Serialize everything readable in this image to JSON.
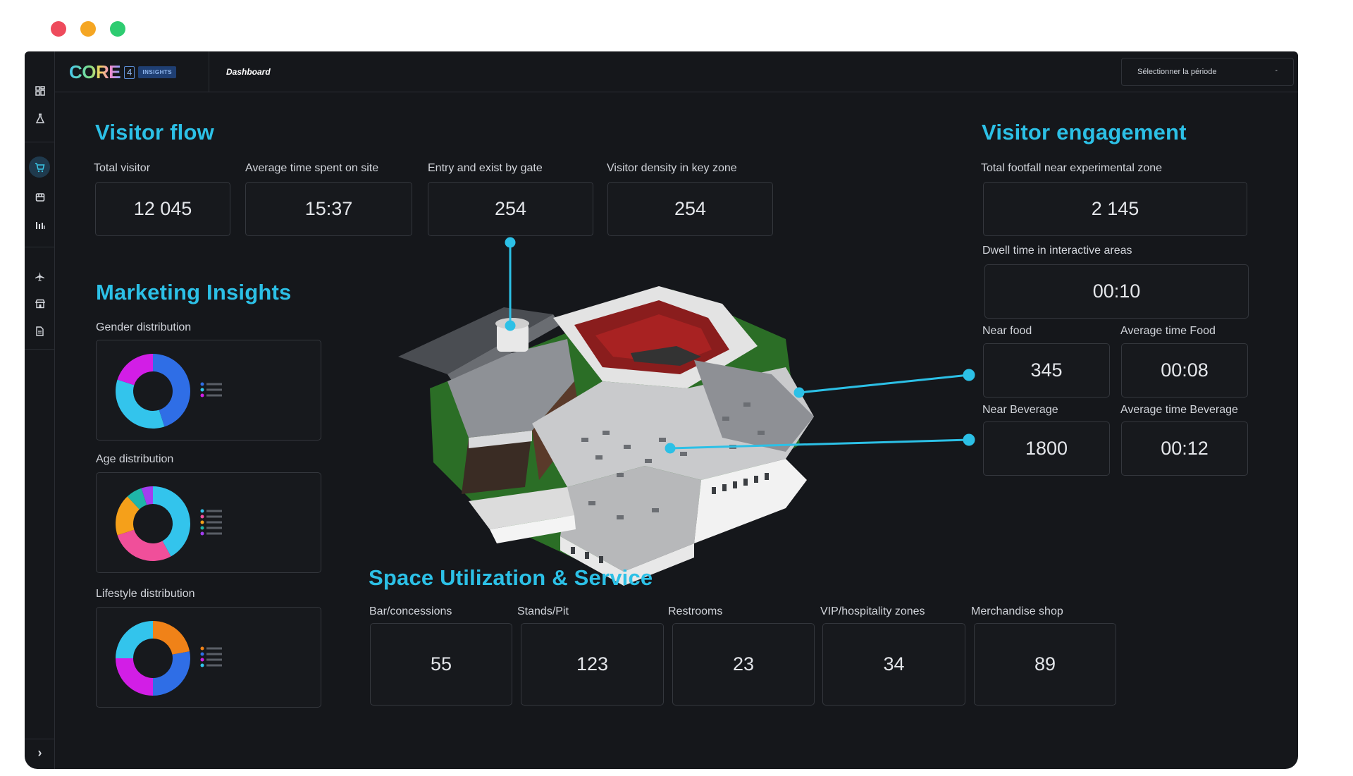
{
  "window_controls": {
    "close_color": "#ee4b5c",
    "minimize_color": "#f5a623",
    "maximize_color": "#2ecc71"
  },
  "brand": {
    "logo_text": "CORE",
    "logo_number": "4",
    "logo_badge": "INSIGHTS"
  },
  "breadcrumb": "Dashboard",
  "period_select": {
    "label": "Sélectionner la période",
    "caret": "-"
  },
  "sidebar": {
    "icons": [
      "dashboard-icon",
      "flask-icon",
      "cart-icon",
      "store-icon",
      "bar-chart-icon",
      "plane-icon",
      "shop-icon",
      "document-icon"
    ],
    "expand": "›"
  },
  "visitor_flow": {
    "title": "Visitor flow",
    "metrics": [
      {
        "label": "Total visitor",
        "value": "12 045"
      },
      {
        "label": "Average time spent on site",
        "value": "15:37"
      },
      {
        "label": "Entry and exist by gate",
        "value": "254"
      },
      {
        "label": "Visitor density in key zone",
        "value": "254"
      }
    ]
  },
  "marketing": {
    "title": "Marketing Insights",
    "gender_label": "Gender distribution",
    "age_label": "Age distribution",
    "lifestyle_label": "Lifestyle distribution"
  },
  "engagement": {
    "title": "Visitor engagement",
    "footfall": {
      "label": "Total footfall near experimental zone",
      "value": "2 145"
    },
    "dwell": {
      "label": "Dwell time in interactive areas",
      "value": "00:10"
    },
    "near_food": {
      "label": "Near food",
      "value": "345"
    },
    "avg_food": {
      "label": "Average time Food",
      "value": "00:08"
    },
    "near_bev": {
      "label": "Near Beverage",
      "value": "1800"
    },
    "avg_bev": {
      "label": "Average time Beverage",
      "value": "00:12"
    }
  },
  "space": {
    "title": "Space Utilization & Service",
    "metrics": [
      {
        "label": "Bar/concessions",
        "value": "55"
      },
      {
        "label": "Stands/Pit",
        "value": "123"
      },
      {
        "label": "Restrooms",
        "value": "23"
      },
      {
        "label": "VIP/hospitality zones",
        "value": "34"
      },
      {
        "label": "Merchandise shop",
        "value": "89"
      }
    ]
  },
  "chart_data": [
    {
      "type": "pie",
      "name": "gender",
      "values": [
        45,
        35,
        20
      ],
      "colors": [
        "#2f6ee6",
        "#33c4ec",
        "#d21ee6"
      ]
    },
    {
      "type": "pie",
      "name": "age",
      "values": [
        42,
        28,
        18,
        7,
        5
      ],
      "colors": [
        "#33c4ec",
        "#f04f9a",
        "#f5a01a",
        "#1fb5a8",
        "#a23ef0"
      ]
    },
    {
      "type": "pie",
      "name": "lifestyle",
      "values": [
        22,
        28,
        25,
        25
      ],
      "colors": [
        "#f08218",
        "#2f6ee6",
        "#d21ee6",
        "#33c4ec"
      ]
    }
  ],
  "accent_color": "#2cc0e6"
}
